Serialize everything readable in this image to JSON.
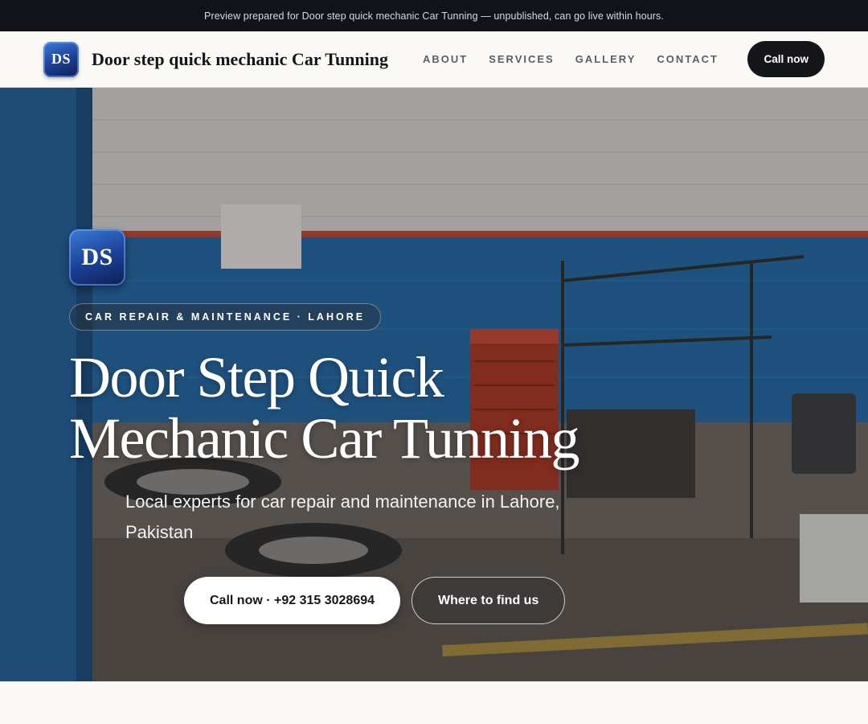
{
  "preview_banner": "Preview prepared for Door step quick mechanic Car Tunning — unpublished, can go live within hours.",
  "header": {
    "logo_text": "DS",
    "brand": "Door step quick mechanic Car Tunning",
    "nav": [
      "ABOUT",
      "SERVICES",
      "GALLERY",
      "CONTACT"
    ],
    "cta": "Call now"
  },
  "hero": {
    "logo_text": "DS",
    "eyebrow": "CAR REPAIR & MAINTENANCE · LAHORE",
    "title_line1": "Door Step Quick",
    "title_line2": "Mechanic Car Tunning",
    "subtitle": "Local experts for car repair and maintenance in Lahore, Pakistan",
    "primary_button": "Call now · +92 315 3028694",
    "secondary_button": "Where to find us"
  },
  "colors": {
    "dark": "#15161a",
    "logo_blue": "#1c3f94",
    "background": "#faf9f6"
  }
}
